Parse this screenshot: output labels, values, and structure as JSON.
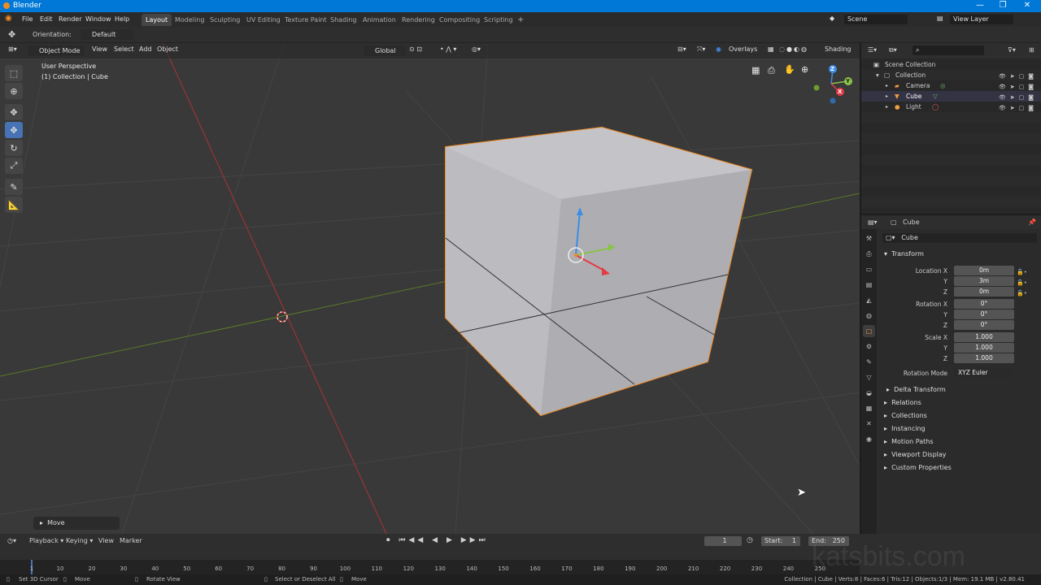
{
  "window": {
    "title": "Blender",
    "controls": [
      "—",
      "❐",
      "✕"
    ]
  },
  "menu": [
    "File",
    "Edit",
    "Render",
    "Window",
    "Help"
  ],
  "workspaces": [
    {
      "label": "Layout",
      "active": true
    },
    {
      "label": "Modeling"
    },
    {
      "label": "Sculpting"
    },
    {
      "label": "UV Editing"
    },
    {
      "label": "Texture Paint"
    },
    {
      "label": "Shading"
    },
    {
      "label": "Animation"
    },
    {
      "label": "Rendering"
    },
    {
      "label": "Compositing"
    },
    {
      "label": "Scripting"
    }
  ],
  "add_workspace": "+",
  "scene": {
    "name": "Scene",
    "view_layer": "View Layer"
  },
  "tool_header": {
    "orientation_label": "Orientation:",
    "orientation_value": "Default"
  },
  "viewport": {
    "mode": "Object Mode",
    "menus": [
      "View",
      "Select",
      "Add",
      "Object"
    ],
    "transform_orientation": "Global",
    "overlays_label": "Overlays",
    "shading_label": "Shading",
    "info_line1": "User Perspective",
    "info_line2": "(1) Collection | Cube",
    "last_op": "Move",
    "gizmo_axes": [
      "Z",
      "Y",
      "X"
    ]
  },
  "outliner": {
    "root": "Scene Collection",
    "collection": "Collection",
    "items": [
      "Camera",
      "Cube",
      "Light"
    ]
  },
  "properties": {
    "object_name": "Cube",
    "data_name": "Cube",
    "transform_label": "Transform",
    "location": {
      "label": "Location X",
      "x": "0m",
      "y": "3m",
      "z": "0m"
    },
    "rotation": {
      "label": "Rotation X",
      "x": "0°",
      "y": "0°",
      "z": "0°"
    },
    "scale": {
      "label": "Scale X",
      "x": "1.000",
      "y": "1.000",
      "z": "1.000"
    },
    "axis_y": "Y",
    "axis_z": "Z",
    "rotation_mode_label": "Rotation Mode",
    "rotation_mode_value": "XYZ Euler",
    "delta_transform": "Delta Transform",
    "panels": [
      "Relations",
      "Collections",
      "Instancing",
      "Motion Paths",
      "Viewport Display",
      "Custom Properties"
    ]
  },
  "timeline": {
    "menus": [
      "Playback",
      "Keying",
      "View",
      "Marker"
    ],
    "current_frame": "1",
    "start_label": "Start:",
    "start": "1",
    "end_label": "End:",
    "end": "250",
    "ticks": [
      "1",
      "10",
      "20",
      "30",
      "40",
      "50",
      "60",
      "70",
      "80",
      "90",
      "100",
      "110",
      "120",
      "130",
      "140",
      "150",
      "160",
      "170",
      "180",
      "190",
      "200",
      "210",
      "220",
      "230",
      "240",
      "250"
    ]
  },
  "status": {
    "hints": [
      "Set 3D Cursor",
      "Move",
      "Rotate View",
      "Select or Deselect All",
      "Move"
    ],
    "stats": "Collection | Cube | Verts:8 | Faces:6 | Tris:12 | Objects:1/3 | Mem: 19.1 MB | v2.80.41"
  },
  "watermark": "katsbits.com"
}
